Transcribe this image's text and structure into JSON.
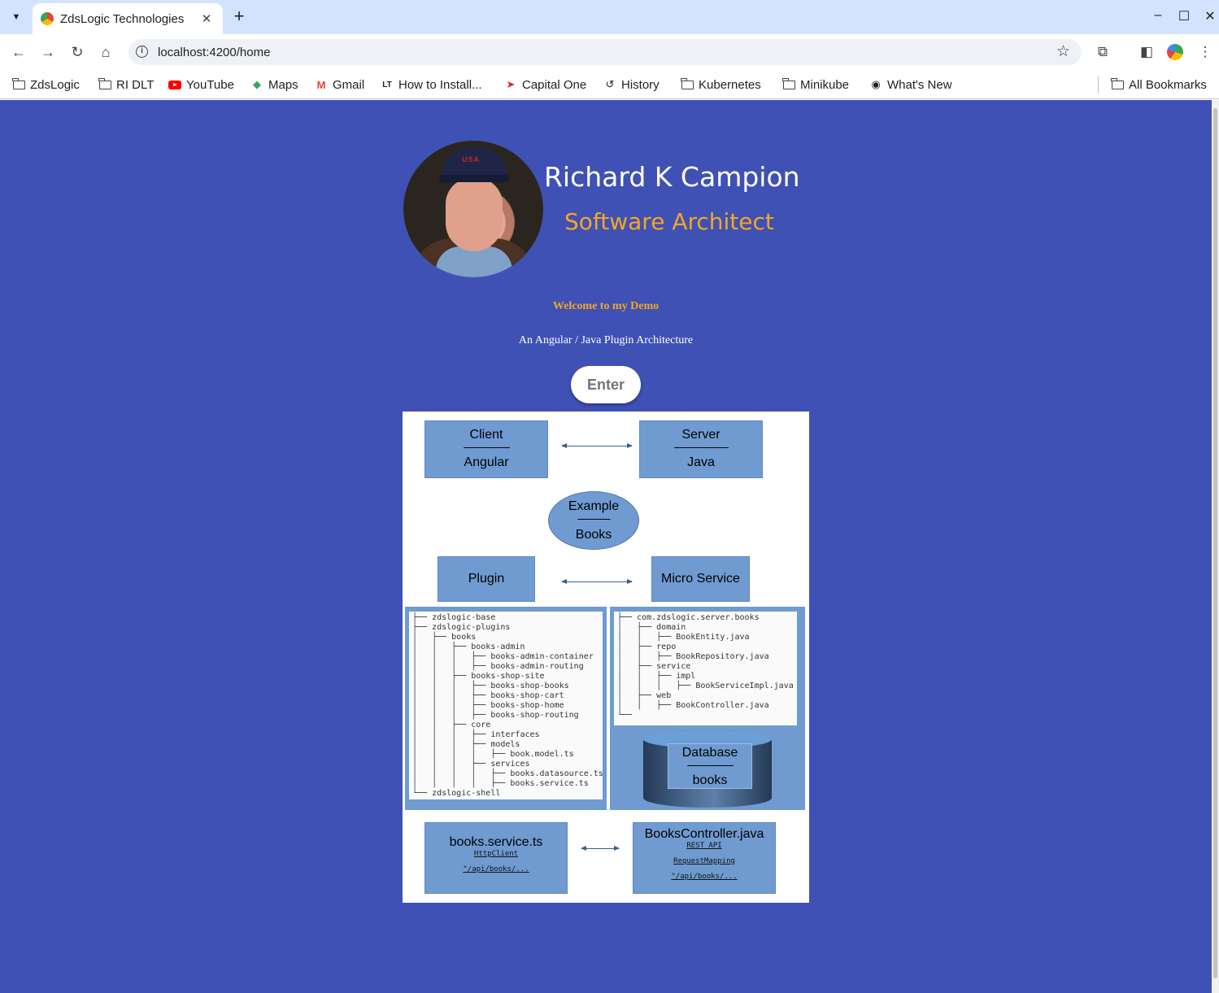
{
  "browser": {
    "tab_title": "ZdsLogic Technologies",
    "url": "localhost:4200/home",
    "bookmarks": [
      {
        "label": "ZdsLogic",
        "icon": "folder-icon"
      },
      {
        "label": "RI DLT",
        "icon": "folder-icon"
      },
      {
        "label": "YouTube",
        "icon": "youtube-icon"
      },
      {
        "label": "Maps",
        "icon": "maps-icon"
      },
      {
        "label": "Gmail",
        "icon": "gmail-icon"
      },
      {
        "label": "How to Install...",
        "icon": "lt-icon"
      },
      {
        "label": "Capital One",
        "icon": "capital-one-icon"
      },
      {
        "label": "History",
        "icon": "history-icon"
      },
      {
        "label": "Kubernetes",
        "icon": "folder-icon"
      },
      {
        "label": "Minikube",
        "icon": "folder-icon"
      },
      {
        "label": "What's New",
        "icon": "chrome-icon"
      }
    ],
    "all_bookmarks": "All Bookmarks"
  },
  "hero": {
    "name": "Richard K Campion",
    "role": "Software Architect",
    "avatar_cap_text": "USA",
    "welcome": "Welcome to my Demo",
    "subtitle": "An Angular / Java Plugin Architecture",
    "enter_label": "Enter"
  },
  "diagram": {
    "client": {
      "title": "Client",
      "dash": "-----------------",
      "sub": "Angular"
    },
    "server": {
      "title": "Server",
      "dash": "--------------------",
      "sub": "Java"
    },
    "example": {
      "title": "Example",
      "dash": "------------",
      "sub": "Books"
    },
    "plugin": "Plugin",
    "micro_service": "Micro Service",
    "client_tree": "├── zdslogic-base\n├── zdslogic-plugins\n│   ├── books\n│   │   ├── books-admin\n│   │   │   ├── books-admin-container\n│   │   │   ├── books-admin-routing\n│   │   ├── books-shop-site\n│   │   │   ├── books-shop-books\n│   │   │   ├── books-shop-cart\n│   │   │   ├── books-shop-home\n│   │   │   ├── books-shop-routing\n│   │   ├── core\n│   │   │   ├── interfaces\n│   │   │   ├── models\n│   │   │   │   ├── book.model.ts\n│   │   │   ├── services\n│   │   │   │   ├── books.datasource.ts\n│   │   │   │   ├── books.service.ts\n└── zdslogic-shell",
    "server_tree": "├── com.zdslogic.server.books\n│   ├── domain\n│   │   ├── BookEntity.java\n│   ├── repo\n│   │   ├── BookRepository.java\n│   ├── service\n│   │   ├── impl\n│   │   │   ├── BookServiceImpl.java\n│   ├── web\n│   │   ├── BookController.java\n└──",
    "database": {
      "title": "Database",
      "dash": "-----------------",
      "sub": "books"
    },
    "client_code": {
      "title": "books.service.ts",
      "line1": "HttpClient",
      "line2": "\"/api/books/..."
    },
    "server_code": {
      "title": "BooksController.java",
      "line1": "REST API",
      "line2": "RequestMapping",
      "line3": "\"/api/books/..."
    }
  },
  "colors": {
    "page_bg": "#3f51b5",
    "accent": "#f5a623",
    "diagram_box": "#6f9bd1"
  }
}
